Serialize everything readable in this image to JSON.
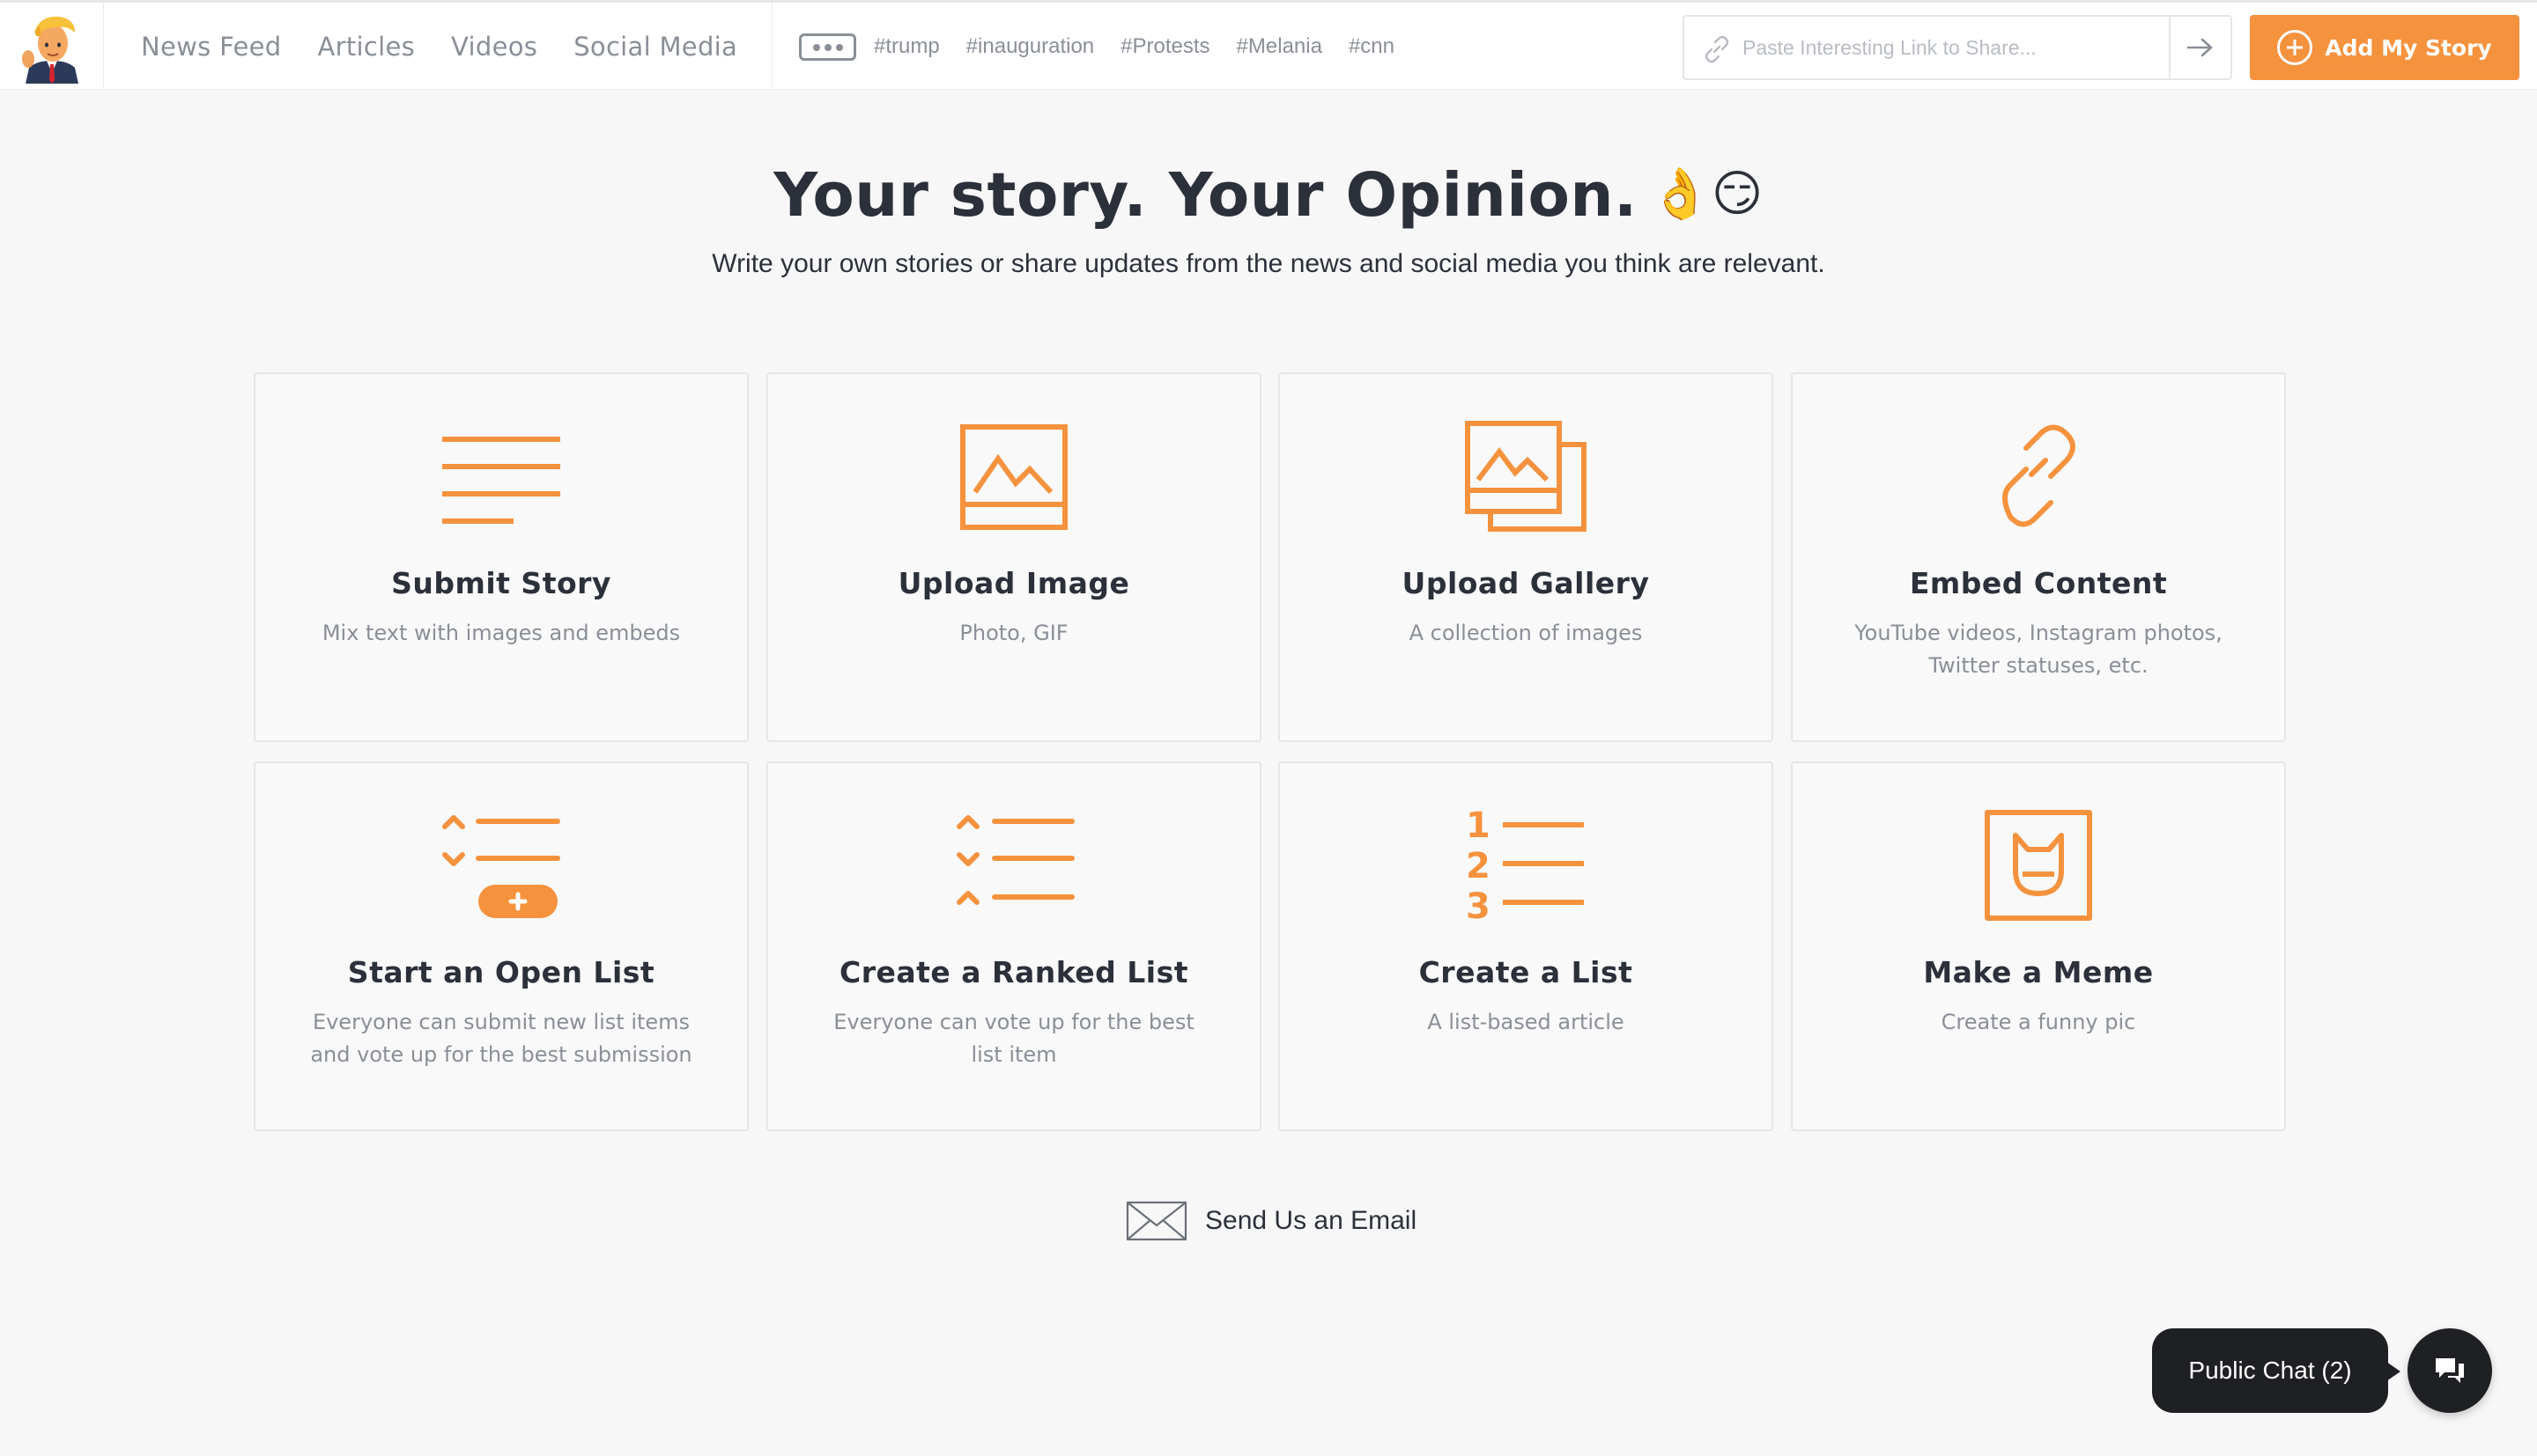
{
  "nav": {
    "links": [
      "News Feed",
      "Articles",
      "Videos",
      "Social Media"
    ],
    "tags": [
      "#trump",
      "#inauguration",
      "#Protests",
      "#Melania",
      "#cnn"
    ],
    "link_placeholder": "Paste Interesting Link to Share...",
    "add_story_label": "Add My Story"
  },
  "hero": {
    "title": "Your story. Your Opinion.",
    "emoji": "👌😏",
    "subtitle": "Write your own stories or share updates from the news and social media you think are relevant."
  },
  "cards": [
    {
      "title": "Submit Story",
      "desc": "Mix text with images and embeds",
      "icon": "text-lines-icon"
    },
    {
      "title": "Upload Image",
      "desc": "Photo, GIF",
      "icon": "image-icon"
    },
    {
      "title": "Upload Gallery",
      "desc": "A collection of images",
      "icon": "gallery-icon"
    },
    {
      "title": "Embed Content",
      "desc": "YouTube videos, Instagram photos, Twitter statuses, etc.",
      "icon": "chain-link-icon"
    },
    {
      "title": "Start an Open List",
      "desc": "Everyone can submit new list items and vote up for the best submission",
      "icon": "open-list-icon"
    },
    {
      "title": "Create a Ranked List",
      "desc": "Everyone can vote up for the best list item",
      "icon": "ranked-list-icon"
    },
    {
      "title": "Create a List",
      "desc": "A list-based article",
      "icon": "numbered-list-icon"
    },
    {
      "title": "Make a Meme",
      "desc": "Create a funny pic",
      "icon": "meme-icon"
    }
  ],
  "email": {
    "label": "Send Us an Email"
  },
  "chat": {
    "label": "Public Chat (2)"
  },
  "colors": {
    "accent": "#f5923e",
    "text": "#2b303a",
    "muted": "#8a8f97",
    "chat_bg": "#1f2023"
  }
}
